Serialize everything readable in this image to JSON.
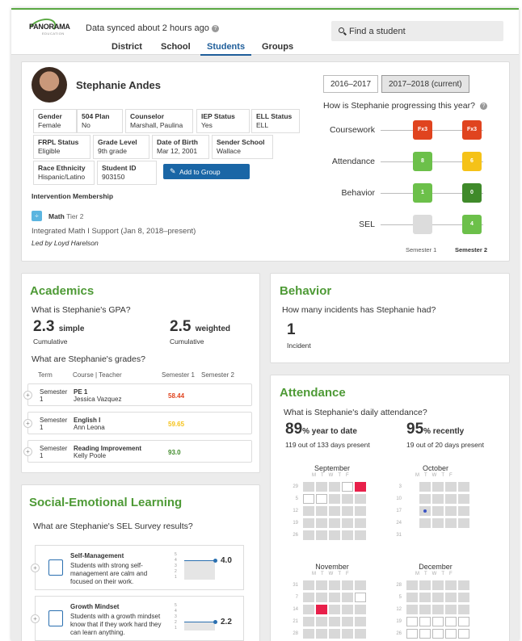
{
  "header": {
    "logo": "PANORAMA",
    "logo_sub": "EDUCATION",
    "sync": "Data synced about 2 hours ago",
    "nav": [
      "District",
      "School",
      "Students",
      "Groups"
    ],
    "search_placeholder": "Find a student"
  },
  "student": {
    "name": "Stephanie Andes",
    "fields": [
      {
        "label": "Gender",
        "value": "Female"
      },
      {
        "label": "504 Plan",
        "value": "No"
      },
      {
        "label": "Counselor",
        "value": "Marshall, Paulina"
      },
      {
        "label": "IEP Status",
        "value": "Yes"
      },
      {
        "label": "ELL Status",
        "value": "ELL"
      },
      {
        "label": "FRPL Status",
        "value": "Eligible"
      },
      {
        "label": "Grade Level",
        "value": "9th grade"
      },
      {
        "label": "Date of Birth",
        "value": "Mar 12, 2001"
      },
      {
        "label": "Sender School",
        "value": "Wallace"
      },
      {
        "label": "Race Ethnicity",
        "value": "Hispanic/Latino"
      },
      {
        "label": "Student ID",
        "value": "903150"
      }
    ],
    "add_group": "Add to Group",
    "intervention": {
      "title": "Intervention Membership",
      "subject": "Math",
      "tier": "Tier 2",
      "program": "Integrated Math I Support (Jan 8, 2018–present)",
      "led": "Led by Loyd Harelson"
    }
  },
  "progress": {
    "years": [
      "2016–2017",
      "2017–2018 (current)"
    ],
    "question": "How is Stephanie progressing this year?",
    "rows": [
      {
        "label": "Coursework",
        "s1": "Fx3",
        "s2": "Fx3",
        "c1": "#e0441f",
        "c2": "#e0441f"
      },
      {
        "label": "Attendance",
        "s1": "8",
        "s2": "6",
        "c1": "#6cc04a",
        "c2": "#f5c218"
      },
      {
        "label": "Behavior",
        "s1": "1",
        "s2": "0",
        "c1": "#6cc04a",
        "c2": "#3f8a2a"
      },
      {
        "label": "SEL",
        "s1": "",
        "s2": "4",
        "c1": "#dcdcdc",
        "c2": "#6cc04a"
      }
    ],
    "sem1": "Semester 1",
    "sem2": "Semester 2"
  },
  "academics": {
    "title": "Academics",
    "gpa_q": "What is Stephanie's GPA?",
    "simple": "2.3",
    "simple_lbl": "simple",
    "weighted": "2.5",
    "weighted_lbl": "weighted",
    "cum": "Cumulative",
    "grades_q": "What are Stephanie's grades?",
    "cols": [
      "Term",
      "Course | Teacher",
      "Semester 1",
      "Semester 2"
    ],
    "rows": [
      {
        "term": "Semester",
        "n": "1",
        "course": "PE 1",
        "teacher": "Jessica Vazquez",
        "s1": "58.44",
        "color": "#e0441f"
      },
      {
        "term": "Semester",
        "n": "1",
        "course": "English I",
        "teacher": "Ann Leona",
        "s1": "59.65",
        "color": "#f5c218"
      },
      {
        "term": "Semester",
        "n": "1",
        "course": "Reading Improvement",
        "teacher": "Kelly Poole",
        "s1": "93.0",
        "color": "#3f8a2a"
      }
    ]
  },
  "behavior": {
    "title": "Behavior",
    "q": "How many incidents has Stephanie had?",
    "count": "1",
    "lbl": "Incident"
  },
  "attendance": {
    "title": "Attendance",
    "q": "What is Stephanie's daily attendance?",
    "ytd": "89",
    "ytd_lbl": "% year to date",
    "ytd_sub": "119 out of 133 days present",
    "rec": "95",
    "rec_lbl": "% recently",
    "rec_sub": "19 out of 20 days present",
    "months": [
      {
        "name": "September",
        "weeks": [
          "29",
          "5",
          "12",
          "19",
          "26"
        ]
      },
      {
        "name": "October",
        "weeks": [
          "3",
          "10",
          "17",
          "24",
          "31"
        ]
      },
      {
        "name": "November",
        "weeks": [
          "31",
          "7",
          "14",
          "21",
          "28"
        ]
      },
      {
        "name": "December",
        "weeks": [
          "28",
          "5",
          "12",
          "19",
          "26"
        ]
      }
    ],
    "dow": "MTWTF"
  },
  "sel": {
    "title": "Social-Emotional Learning",
    "q": "What are Stephanie's SEL Survey results?",
    "items": [
      {
        "name": "Self-Management",
        "desc": "Students with strong self-management are calm and focused on their work.",
        "score": 4.0,
        "score_text": "4.0"
      },
      {
        "name": "Growth Mindset",
        "desc": "Students with a growth mindset know that if they work hard they can learn anything.",
        "score": 2.2,
        "score_text": "2.2"
      }
    ],
    "axis": [
      "5",
      "4",
      "3",
      "2",
      "1"
    ]
  }
}
